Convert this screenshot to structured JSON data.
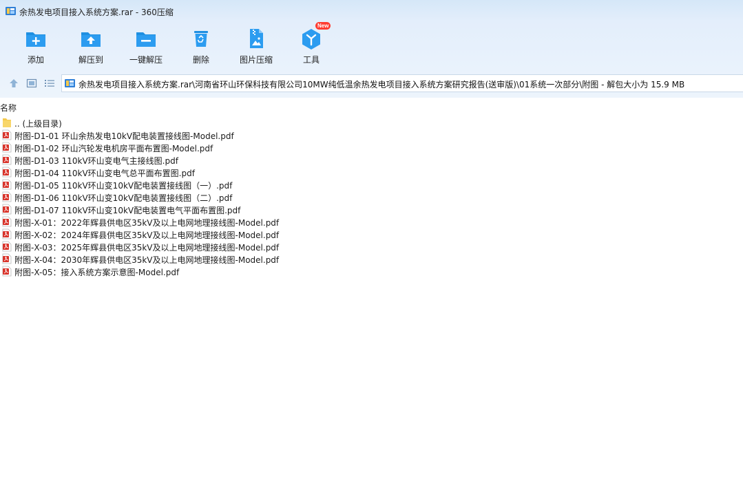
{
  "window": {
    "title": "余热发电项目接入系统方案.rar - 360压缩"
  },
  "toolbar": {
    "buttons": [
      {
        "label": "添加",
        "icon": "add-folder-icon"
      },
      {
        "label": "解压到",
        "icon": "extract-to-icon"
      },
      {
        "label": "一键解压",
        "icon": "one-click-extract-icon"
      },
      {
        "label": "删除",
        "icon": "recycle-bin-icon"
      },
      {
        "label": "图片压缩",
        "icon": "image-compress-icon"
      },
      {
        "label": "工具",
        "icon": "tools-icon",
        "badge": "New"
      }
    ]
  },
  "nav": {
    "up_icon": "arrow-up-icon",
    "view_icon": "thumbnail-view-icon",
    "list_icon": "list-view-icon"
  },
  "address": {
    "path": "余热发电项目接入系统方案.rar\\河南省环山环保科技有限公司10MW纯低温余热发电项目接入系统方案研究报告(送审版)\\01系统一次部分\\附图 - 解包大小为 15.9 MB"
  },
  "filelist": {
    "header": "名称",
    "items": [
      {
        "name": ".. (上级目录)",
        "icon": "folder-icon"
      },
      {
        "name": "附图-D1-01  环山余热发电10kV配电装置接线图-Model.pdf",
        "icon": "pdf-icon"
      },
      {
        "name": "附图-D1-02  环山汽轮发电机房平面布置图-Model.pdf",
        "icon": "pdf-icon"
      },
      {
        "name": "附图-D1-03  110kV环山变电气主接线图.pdf",
        "icon": "pdf-icon"
      },
      {
        "name": "附图-D1-04  110kV环山变电气总平面布置图.pdf",
        "icon": "pdf-icon"
      },
      {
        "name": "附图-D1-05  110kV环山变10kV配电装置接线图（一）.pdf",
        "icon": "pdf-icon"
      },
      {
        "name": "附图-D1-06  110kV环山变10kV配电装置接线图（二）.pdf",
        "icon": "pdf-icon"
      },
      {
        "name": "附图-D1-07  110kV环山变10kV配电装置电气平面布置图.pdf",
        "icon": "pdf-icon"
      },
      {
        "name": "附图-X-01：2022年辉县供电区35kV及以上电网地理接线图-Model.pdf",
        "icon": "pdf-icon"
      },
      {
        "name": "附图-X-02：2024年辉县供电区35kV及以上电网地理接线图-Model.pdf",
        "icon": "pdf-icon"
      },
      {
        "name": "附图-X-03：2025年辉县供电区35kV及以上电网地理接线图-Model.pdf",
        "icon": "pdf-icon"
      },
      {
        "name": "附图-X-04：2030年辉县供电区35kV及以上电网地理接线图-Model.pdf",
        "icon": "pdf-icon"
      },
      {
        "name": "附图-X-05：接入系统方案示意图-Model.pdf",
        "icon": "pdf-icon"
      }
    ]
  },
  "colors": {
    "accent": "#1e8fe1",
    "pdf_red": "#d9342b",
    "folder_yellow": "#f5c94c",
    "badge_red": "#ff3b30"
  }
}
